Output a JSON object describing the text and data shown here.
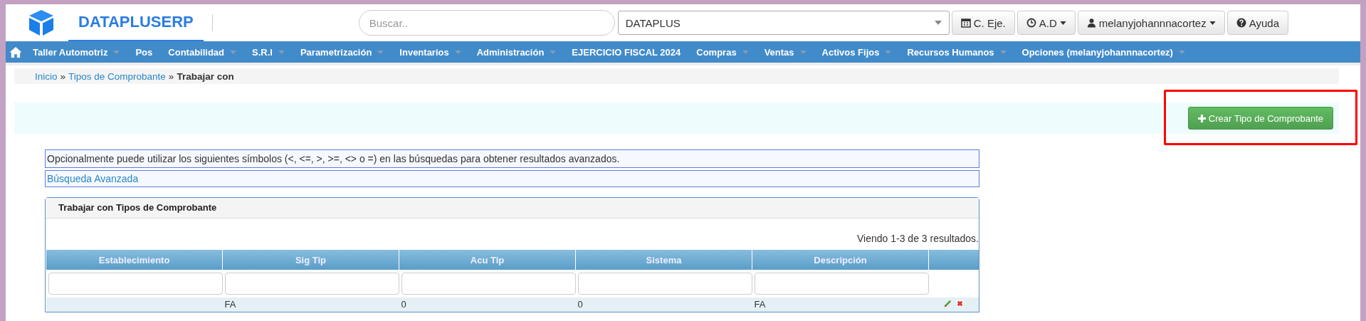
{
  "header": {
    "brand": "DATAPLUSERP",
    "search": {
      "placeholder": "Buscar.."
    },
    "company_select": {
      "value": "DATAPLUS"
    },
    "buttons": [
      {
        "kind": "calendar",
        "label": "C. Eje.",
        "dropdown": false
      },
      {
        "kind": "clock",
        "label": "A.D",
        "dropdown": true
      },
      {
        "kind": "user",
        "label": "melanyjohannnacortez",
        "dropdown": true
      },
      {
        "kind": "help",
        "label": "Ayuda",
        "dropdown": false
      }
    ]
  },
  "nav": {
    "items": [
      {
        "label": "Taller Automotriz",
        "dropdown": true
      },
      {
        "label": "Pos",
        "dropdown": false
      },
      {
        "label": "Contabilidad",
        "dropdown": true
      },
      {
        "label": "S.R.I",
        "dropdown": true
      },
      {
        "label": "Parametrización",
        "dropdown": true
      },
      {
        "label": "Inventarios",
        "dropdown": true
      },
      {
        "label": "Administración",
        "dropdown": true
      },
      {
        "label": "EJERCICIO FISCAL 2024",
        "dropdown": false
      },
      {
        "label": "Compras",
        "dropdown": true
      },
      {
        "label": "Ventas",
        "dropdown": true
      },
      {
        "label": "Activos Fijos",
        "dropdown": true
      },
      {
        "label": "Recursos Humanos",
        "dropdown": true
      },
      {
        "label": "Opciones (melanyjohannnacortez)",
        "dropdown": true
      }
    ]
  },
  "breadcrumb": [
    {
      "kind": "link",
      "text": "Inicio"
    },
    {
      "kind": "separator",
      "text": "»"
    },
    {
      "kind": "link",
      "text": "Tipos de Comprobante"
    },
    {
      "kind": "separator",
      "text": "»"
    },
    {
      "kind": "current",
      "text": "Trabajar con"
    }
  ],
  "create_button": {
    "label": "Crear Tipo de Comprobante"
  },
  "hint": "Opcionalmente puede utilizar los siguientes símbolos (<, <=, >, >=, <> o =) en las búsquedas para obtener resultados avanzados.",
  "advanced_search": {
    "label": "Búsqueda Avanzada"
  },
  "panel": {
    "title": "Trabajar con Tipos de Comprobante",
    "summary": "Viendo 1-3 de 3 resultados.",
    "table": {
      "columns": [
        "Establecimiento",
        "Sig Tip",
        "Acu Tip",
        "Sistema",
        "Descripción"
      ],
      "rows": [
        {
          "cells": [
            null,
            "FA",
            "0",
            "0",
            "FA"
          ],
          "editable": true,
          "deletable": true
        }
      ]
    }
  }
}
